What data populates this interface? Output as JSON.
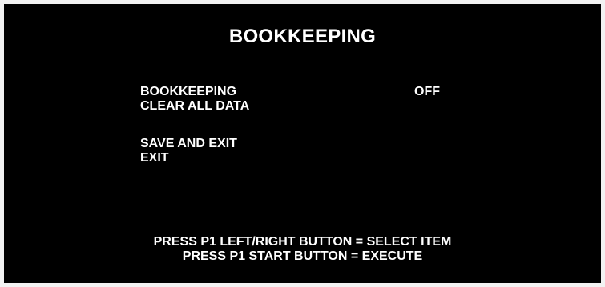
{
  "screen": {
    "title": "BOOKKEEPING",
    "menu": {
      "items": [
        {
          "label": "BOOKKEEPING",
          "value": "OFF"
        },
        {
          "label": "CLEAR ALL DATA"
        },
        {
          "label": "SAVE AND EXIT"
        },
        {
          "label": "EXIT"
        }
      ]
    },
    "instructions": {
      "line1": "PRESS P1 LEFT/RIGHT BUTTON = SELECT ITEM",
      "line2": "PRESS P1 START BUTTON = EXECUTE"
    }
  },
  "colors": {
    "background": "#000000",
    "text": "#ffffff",
    "frame": "#f2f2f2"
  }
}
